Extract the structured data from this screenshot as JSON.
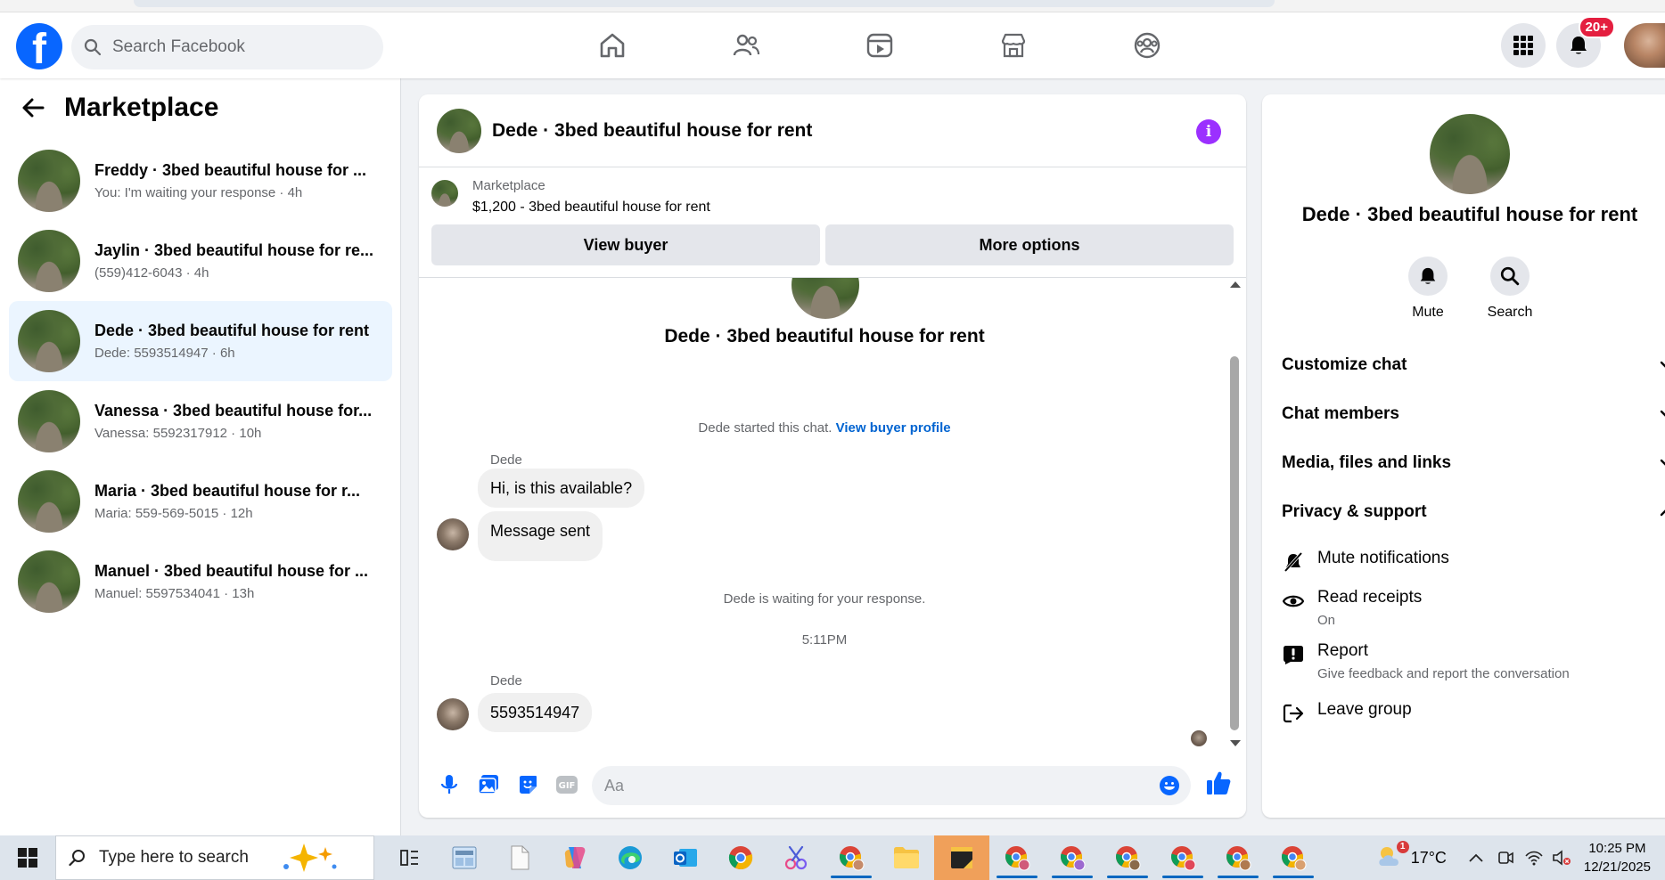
{
  "header": {
    "logo_letter": "f",
    "search_placeholder": "Search Facebook",
    "notification_count": "20+"
  },
  "sidebar": {
    "title": "Marketplace",
    "conversations": [
      {
        "title": "Freddy · 3bed beautiful house for ...",
        "subtitle": "You: I'm waiting your response · 4h",
        "active": false
      },
      {
        "title": "Jaylin · 3bed beautiful house for re...",
        "subtitle": "(559)412-6043 · 4h",
        "active": false
      },
      {
        "title": "Dede · 3bed beautiful house for rent",
        "subtitle": "Dede: 5593514947 · 6h",
        "active": true
      },
      {
        "title": "Vanessa · 3bed beautiful house for...",
        "subtitle": "Vanessa: 5592317912 · 10h",
        "active": false
      },
      {
        "title": "Maria · 3bed beautiful house for r...",
        "subtitle": "Maria: 559-569-5015 · 12h",
        "active": false
      },
      {
        "title": "Manuel · 3bed beautiful house for ...",
        "subtitle": "Manuel: 5597534041 · 13h",
        "active": false
      }
    ]
  },
  "chat": {
    "title": "Dede · 3bed beautiful house for rent",
    "info_glyph": "i",
    "marketplace_label": "Marketplace",
    "listing_price_title": "$1,200 - 3bed beautiful house for rent",
    "view_buyer_label": "View buyer",
    "more_options_label": "More options",
    "thread_title": "Dede · 3bed beautiful house for rent",
    "started_text": "Dede started this chat.",
    "view_buyer_profile_link": "View buyer profile",
    "sender_name_1": "Dede",
    "message_1": "Hi, is this available?",
    "message_2": "Message sent",
    "waiting_text": "Dede is waiting for your response.",
    "timestamp": "5:11PM",
    "sender_name_2": "Dede",
    "message_3": "5593514947",
    "composer_placeholder": "Aa"
  },
  "details": {
    "title": "Dede · 3bed beautiful house for rent",
    "mute_label": "Mute",
    "search_label": "Search",
    "sections": {
      "customize_chat": "Customize chat",
      "chat_members": "Chat members",
      "media_files_links": "Media, files and links",
      "privacy_support": "Privacy & support"
    },
    "items": {
      "mute_notifications": "Mute notifications",
      "read_receipts": "Read receipts",
      "read_receipts_status": "On",
      "report": "Report",
      "report_sub": "Give feedback and report the conversation",
      "leave_group": "Leave group"
    }
  },
  "taskbar": {
    "search_placeholder": "Type here to search",
    "weather_alert": "1",
    "temperature": "17°C",
    "time": "10:25 PM",
    "date": "12/21/2025"
  },
  "colors": {
    "brand_blue": "#0866ff",
    "link_blue": "#0064d1",
    "active_conv_bg": "#ebf5ff",
    "info_purple": "#9b30ff",
    "badge_red": "#e41e3f"
  }
}
